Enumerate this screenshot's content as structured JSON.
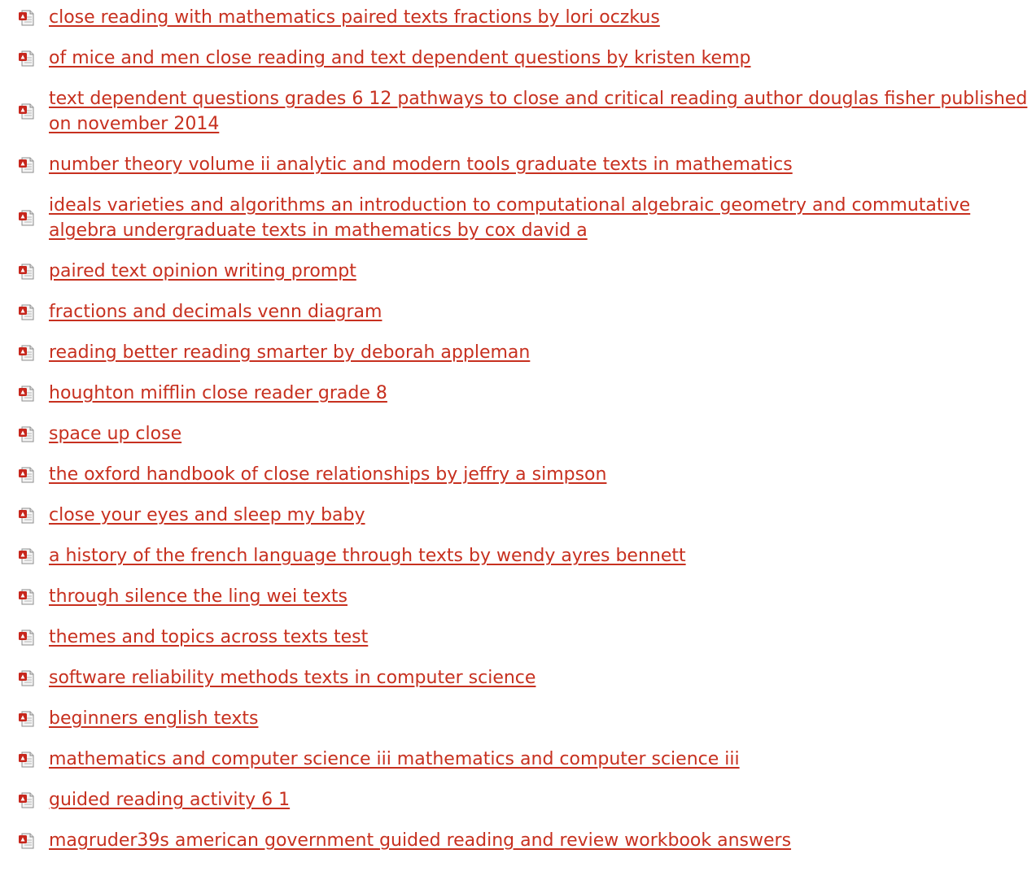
{
  "icon": "pdf-file-icon",
  "link_color": "#c7301f",
  "documents": [
    {
      "title": "close reading with mathematics paired texts fractions by lori oczkus"
    },
    {
      "title": "of mice and men close reading and text dependent questions by kristen kemp"
    },
    {
      "title": "text dependent questions grades 6 12 pathways to close and critical reading author douglas fisher published on november 2014"
    },
    {
      "title": "number theory volume ii analytic and modern tools graduate texts in mathematics"
    },
    {
      "title": "ideals varieties and algorithms an introduction to computational algebraic geometry and commutative algebra undergraduate texts in mathematics by cox david a"
    },
    {
      "title": "paired text opinion writing prompt"
    },
    {
      "title": "fractions and decimals venn diagram"
    },
    {
      "title": "reading better reading smarter by deborah appleman"
    },
    {
      "title": "houghton mifflin close reader grade 8"
    },
    {
      "title": "space up close"
    },
    {
      "title": "the oxford handbook of close relationships by jeffry a simpson"
    },
    {
      "title": "close your eyes and sleep my baby"
    },
    {
      "title": "a history of the french language through texts by wendy ayres bennett"
    },
    {
      "title": "through silence the ling wei texts"
    },
    {
      "title": "themes and topics across texts test"
    },
    {
      "title": "software reliability methods texts in computer science"
    },
    {
      "title": "beginners english texts"
    },
    {
      "title": "mathematics and computer science iii mathematics and computer science iii"
    },
    {
      "title": "guided reading activity 6 1"
    },
    {
      "title": "magruder39s american government guided reading and review workbook answers"
    }
  ]
}
